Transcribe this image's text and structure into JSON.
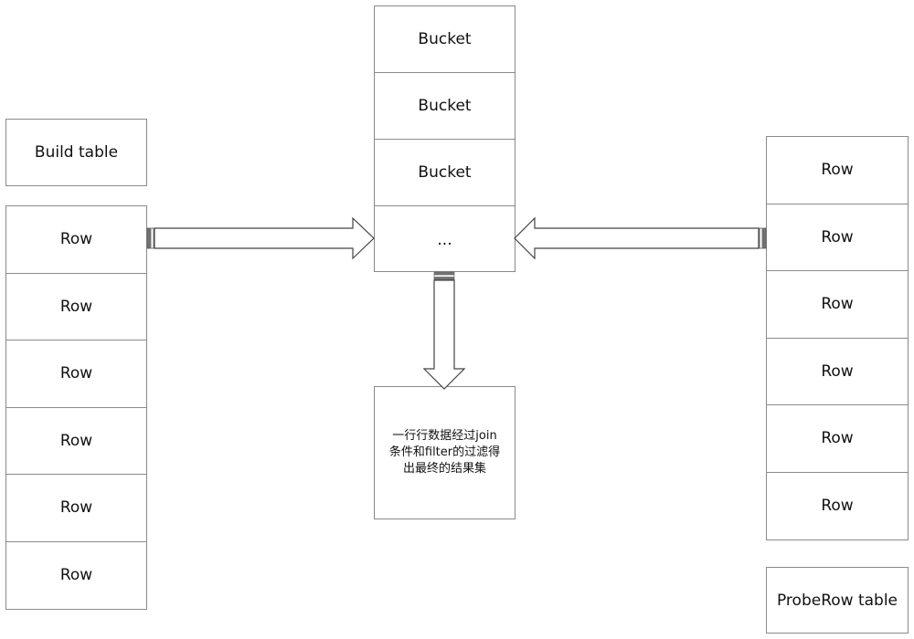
{
  "build_table": {
    "title": "Build table",
    "rows": [
      "Row",
      "Row",
      "Row",
      "Row",
      "Row",
      "Row"
    ]
  },
  "hash_table": {
    "buckets": [
      "Bucket",
      "Bucket",
      "Bucket",
      "..."
    ]
  },
  "result": {
    "text_lines": [
      "一行行数据经过join",
      "条件和filter的过滤得",
      "出最终的结果集"
    ]
  },
  "probe_table": {
    "title": "ProbeRow table",
    "rows": [
      "Row",
      "Row",
      "Row",
      "Row",
      "Row",
      "Row"
    ]
  },
  "colors": {
    "border": "#8a8a8a",
    "text": "#111111",
    "background": "#ffffff"
  }
}
